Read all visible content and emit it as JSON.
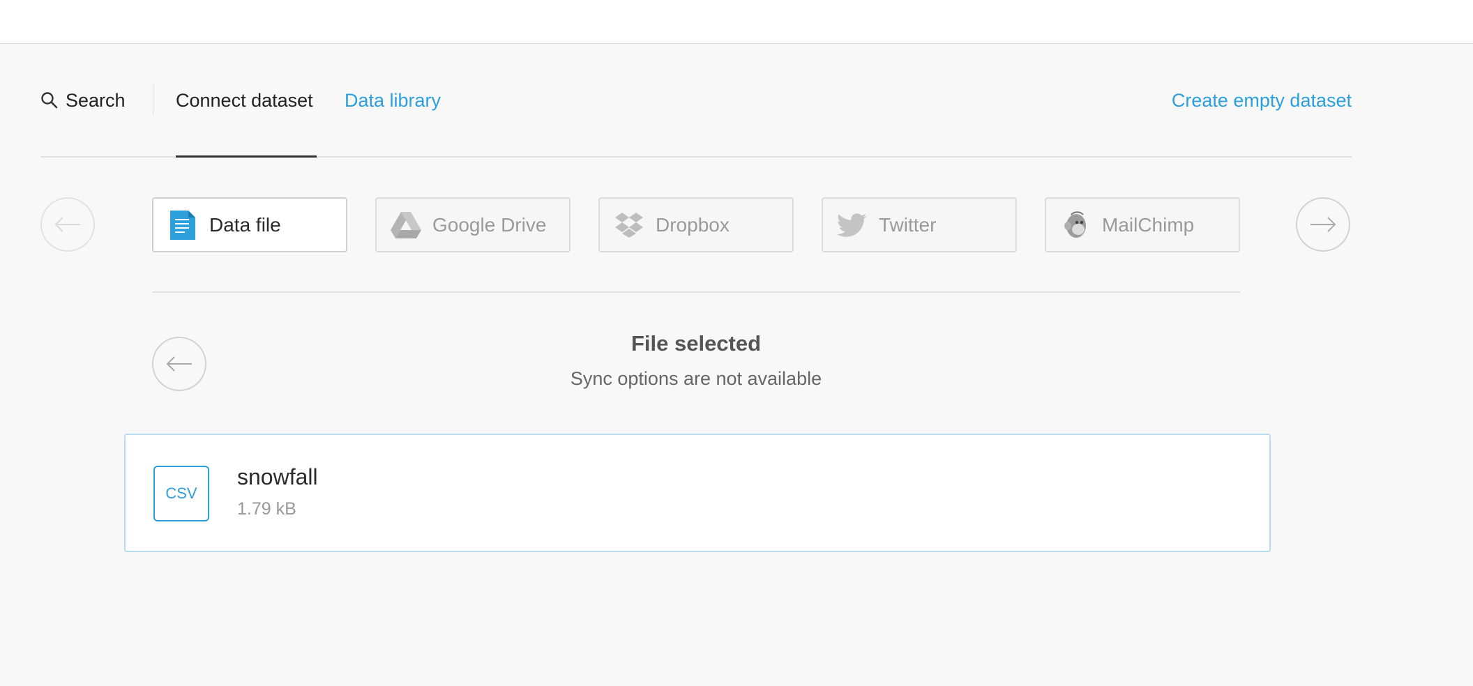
{
  "tabs": {
    "search_label": "Search",
    "connect_label": "Connect dataset",
    "library_label": "Data library",
    "create_label": "Create empty dataset",
    "active": "Connect dataset"
  },
  "sources": [
    {
      "label": "Data file",
      "icon": "document-icon",
      "selected": true
    },
    {
      "label": "Google Drive",
      "icon": "google-drive-icon",
      "selected": false
    },
    {
      "label": "Dropbox",
      "icon": "dropbox-icon",
      "selected": false
    },
    {
      "label": "Twitter",
      "icon": "twitter-icon",
      "selected": false
    },
    {
      "label": "MailChimp",
      "icon": "mailchimp-icon",
      "selected": false
    }
  ],
  "status": {
    "title": "File selected",
    "subtitle": "Sync options are not available"
  },
  "file": {
    "type_badge": "CSV",
    "name": "snowfall",
    "size": "1.79 kB"
  },
  "colors": {
    "accent": "#2d9fdb",
    "background": "#f8f8f8",
    "card_border": "#b9dcef"
  }
}
